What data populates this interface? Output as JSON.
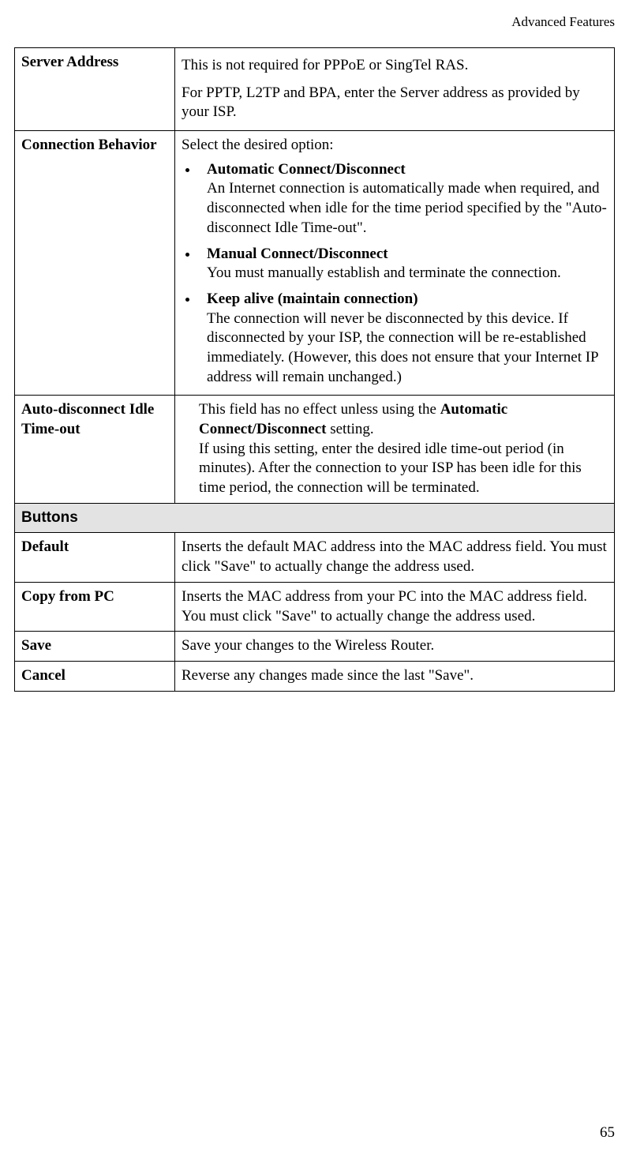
{
  "header": "Advanced Features",
  "page_number": "65",
  "rows": {
    "server_address": {
      "label": "Server Address",
      "p1": "This is not required for PPPoE or SingTel RAS.",
      "p2": "For PPTP, L2TP and BPA, enter the Server address as provided by your ISP."
    },
    "connection_behavior": {
      "label": "Connection Behavior",
      "intro": "Select the desired option:",
      "opt1_title": "Automatic Connect/Disconnect",
      "opt1_body": "An Internet connection is automatically made when required, and disconnected when idle for the time period specified by the \"Auto-disconnect Idle Time-out\".",
      "opt2_title": "Manual Connect/Disconnect",
      "opt2_body": "You must manually establish and terminate the connection.",
      "opt3_title": "Keep alive (maintain connection)",
      "opt3_body": "The connection will never be disconnected by this device. If disconnected by your ISP, the connection will be re-established immediately. (However, this does not ensure that your Internet IP address will remain unchanged.)"
    },
    "auto_disconnect": {
      "label": "Auto-disconnect Idle Time-out",
      "body_pre": "This field has no effect unless using the ",
      "body_bold": "Automatic Connect/Disconnect",
      "body_post1": " setting.",
      "body_line2": "If using this setting, enter the desired idle time-out period (in minutes). After the connection to your ISP has been idle for this time period, the connection will be terminated."
    },
    "buttons_header": "Buttons",
    "default_btn": {
      "label": "Default",
      "body": "Inserts the default MAC address into the MAC address field. You must click \"Save\" to actually change the address used."
    },
    "copy_from_pc": {
      "label": "Copy from PC",
      "body": "Inserts the MAC address from your PC into the MAC address field. You must click \"Save\" to actually change the address used."
    },
    "save": {
      "label": "Save",
      "body": "Save your changes to the Wireless Router."
    },
    "cancel": {
      "label": "Cancel",
      "body": "Reverse any changes made since the last \"Save\"."
    }
  }
}
